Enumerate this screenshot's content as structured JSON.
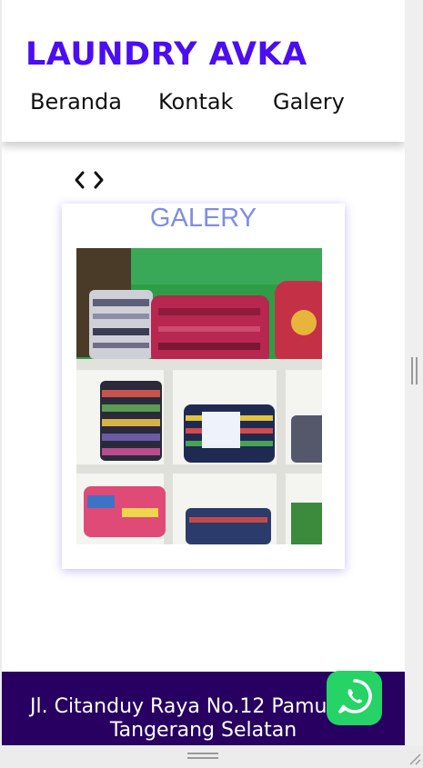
{
  "brand": {
    "title": "LAUNDRY AVKA",
    "color": "#4b0df2"
  },
  "nav": {
    "items": [
      {
        "label": "Beranda"
      },
      {
        "label": "Kontak"
      },
      {
        "label": "Galery"
      }
    ]
  },
  "slider": {
    "prev_icon": "chevron-left-icon",
    "next_icon": "chevron-right-icon"
  },
  "gallery": {
    "title": "GALERY",
    "photo": "laundry-shelf-photo"
  },
  "footer": {
    "address_line1": "Jl. Citanduy Raya No.12 Pamulang",
    "address_line2": "Tangerang Selatan",
    "background": "#270061"
  },
  "whatsapp": {
    "icon": "whatsapp-icon",
    "color": "#26d367"
  }
}
